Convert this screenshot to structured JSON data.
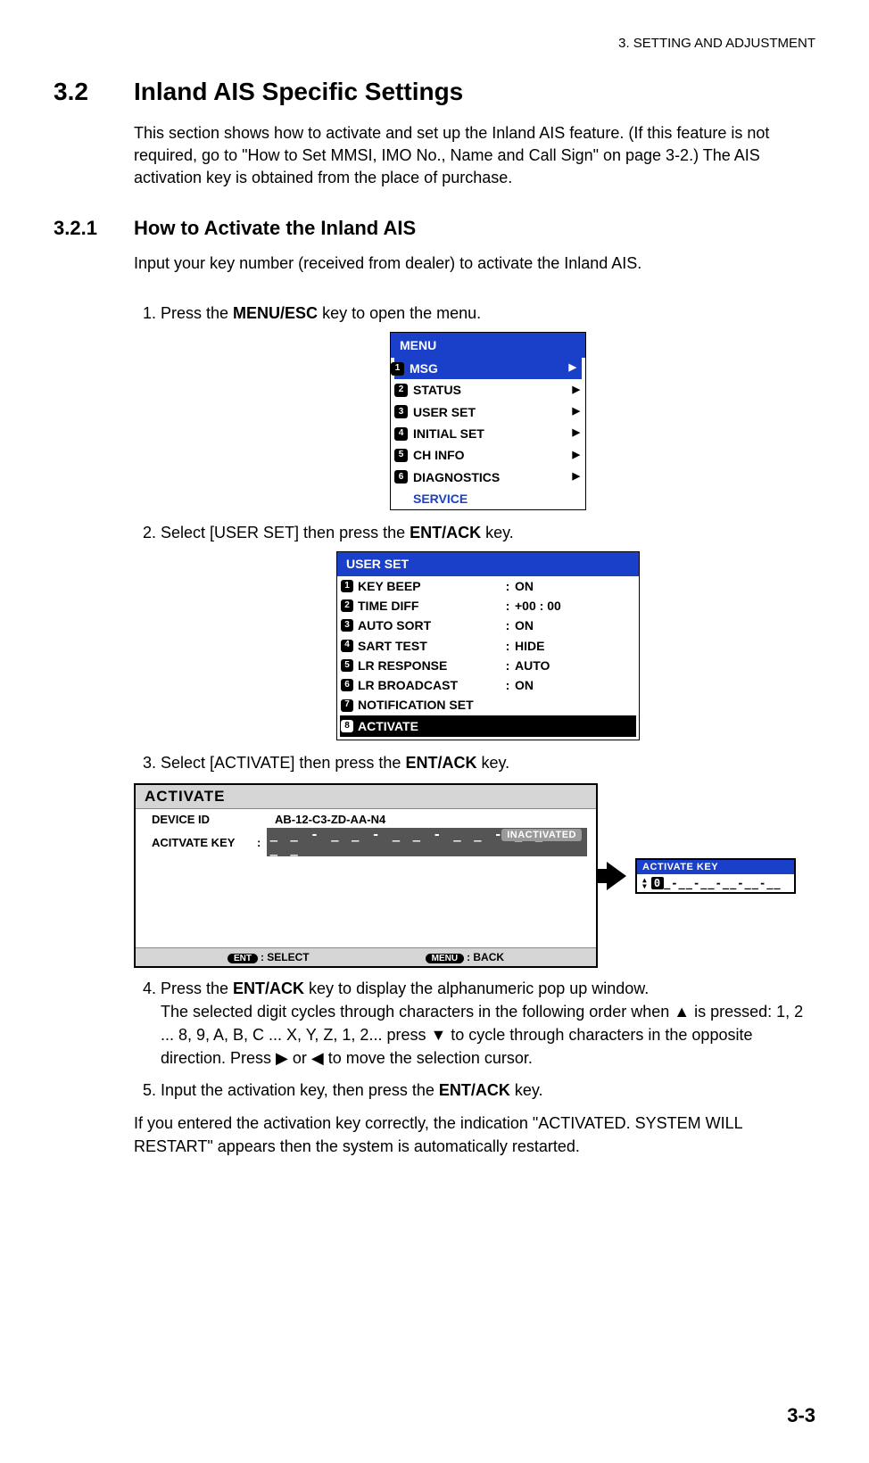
{
  "header": "3.  SETTING AND ADJUSTMENT",
  "section": {
    "num": "3.2",
    "name": "Inland AIS Specific Settings"
  },
  "section_body": "This section shows how to activate and set up the Inland AIS feature. (If this feature is not required, go to \"How to Set MMSI, IMO No., Name and Call Sign\" on page 3-2.) The AIS activation key is obtained from the place of purchase.",
  "subsection": {
    "num": "3.2.1",
    "name": "How to Activate the Inland AIS"
  },
  "sub_intro": "Input your key number (received from dealer) to activate the Inland AIS.",
  "step1": {
    "pre": "Press the ",
    "key": "MENU/ESC",
    "post": " key to open the menu."
  },
  "menu": {
    "title": "MENU",
    "items": [
      "MSG",
      "STATUS",
      "USER SET",
      "INITIAL SET",
      "CH INFO",
      "DIAGNOSTICS"
    ],
    "service": "SERVICE"
  },
  "step2": {
    "pre": "Select [USER SET] then press the ",
    "key": "ENT/ACK",
    "post": " key."
  },
  "userset": {
    "title": "USER SET",
    "rows": [
      {
        "label": "KEY BEEP",
        "value": "ON"
      },
      {
        "label": "TIME DIFF",
        "value": "+00 : 00"
      },
      {
        "label": "AUTO SORT",
        "value": "ON"
      },
      {
        "label": "SART TEST",
        "value": "HIDE"
      },
      {
        "label": "LR RESPONSE",
        "value": "AUTO"
      },
      {
        "label": "LR BROADCAST",
        "value": "ON"
      },
      {
        "label": "NOTIFICATION SET",
        "value": ""
      }
    ],
    "selected": "ACTIVATE"
  },
  "step3": {
    "pre": "Select [ACTIVATE] then press the ",
    "key": "ENT/ACK",
    "post": " key."
  },
  "activate": {
    "title": "ACTIVATE",
    "device_id_label": "DEVICE ID",
    "device_id": "AB-12-C3-ZD-AA-N4",
    "key_label": "ACITVATE KEY",
    "key_slot": "_ _ - _ _ - _ _ - _ _ - _ _ - _ _",
    "status": "INACTIVATED",
    "ent_label": "ENT",
    "select_label": ": SELECT",
    "menu_label": "MENU",
    "back_label": ": BACK"
  },
  "popup": {
    "title": "ACTIVATE KEY",
    "digit": "0",
    "rest": "_-__-__-__-__-__"
  },
  "step4": {
    "pre": "Press the ",
    "key": "ENT/ACK",
    "post": " key to display the alphanumeric pop up window.",
    "cont": "The selected digit cycles through characters in the following order when ▲ is pressed: 1, 2 ... 8, 9, A, B, C ... X, Y, Z, 1, 2... press ▼ to cycle through characters in the opposite direction. Press ▶ or ◀ to move the selection cursor."
  },
  "step5": {
    "pre": "Input the activation key, then press the ",
    "key": "ENT/ACK",
    "post": " key."
  },
  "closing": "If you entered the activation key correctly, the indication \"ACTIVATED. SYSTEM WILL RESTART\" appears then the system is automatically restarted.",
  "page_num": "3-3"
}
